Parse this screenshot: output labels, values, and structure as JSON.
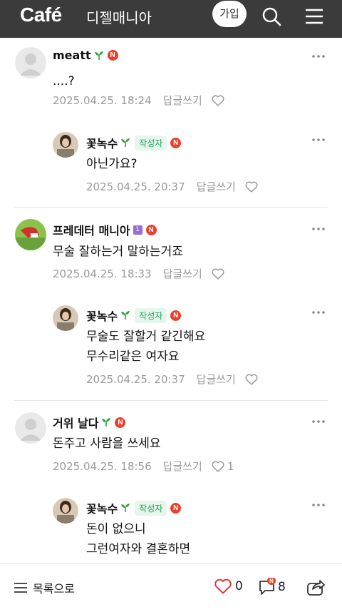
{
  "header": {
    "logo": "Café",
    "cafe_name": "디젤매니아",
    "join_label": "가입",
    "icons": [
      "search-icon",
      "menu-icon"
    ]
  },
  "comments": [
    {
      "nick": "meatt",
      "text": "....?",
      "date": "2025.04.25. 18:24",
      "reply": "답글쓰기",
      "likes": ""
    },
    {
      "nick": "꽃녹수",
      "author_badge": "작성자",
      "text": "아닌가요?",
      "date": "2025.04.25. 20:37",
      "reply": "답글쓰기",
      "likes": ""
    },
    {
      "nick": "프레데터 매니아",
      "level": "1",
      "text": "무술 잘하는거 말하는거죠",
      "date": "2025.04.25. 18:33",
      "reply": "답글쓰기",
      "likes": ""
    },
    {
      "nick": "꽃녹수",
      "author_badge": "작성자",
      "text_lines": [
        "무술도 잘할거 같긴해요",
        "무수리같은 여자요"
      ],
      "date": "2025.04.25. 20:37",
      "reply": "답글쓰기",
      "likes": ""
    },
    {
      "nick": "거위 날다",
      "text": "돈주고 사람을 쓰세요",
      "date": "2025.04.25. 18:56",
      "reply": "답글쓰기",
      "likes": "1"
    },
    {
      "nick": "꽃녹수",
      "author_badge": "작성자",
      "text_lines": [
        "돈이 없으니",
        "그런여자와 결혼하면"
      ]
    }
  ],
  "badge_letter": "N",
  "bottom": {
    "list_label": "목록으로",
    "like_count": "0",
    "comment_count": "8"
  },
  "colors": {
    "topbar": "#3b3b3b",
    "accent_green": "#20a455",
    "badge_red": "#e8412d",
    "heart_red": "#e0383e"
  }
}
